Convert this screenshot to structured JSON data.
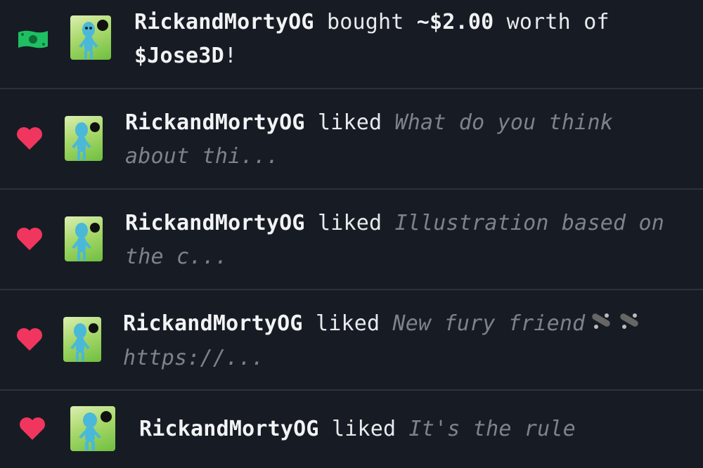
{
  "activity": [
    {
      "type": "buy",
      "icon": "money-icon",
      "user": "RickandMortyOG",
      "verb": "bought",
      "amount": "~$2.00",
      "mid": "worth of",
      "token": "$Jose3D",
      "end": "!"
    },
    {
      "type": "like",
      "icon": "heart-icon",
      "user": "RickandMortyOG",
      "verb": "liked",
      "snippet": "What do you think about thi..."
    },
    {
      "type": "like",
      "icon": "heart-icon",
      "user": "RickandMortyOG",
      "verb": "liked",
      "snippet": "Illustration based on the c..."
    },
    {
      "type": "like",
      "icon": "heart-icon",
      "user": "RickandMortyOG",
      "verb": "liked",
      "snippet_start": "New fury friend",
      "snippet_emoji": "skateboard-icon",
      "snippet_end": "https://..."
    },
    {
      "type": "like",
      "icon": "heart-icon",
      "user": "RickandMortyOG",
      "verb": "liked",
      "snippet": "It's the rule"
    }
  ],
  "colors": {
    "background": "#171c24",
    "divider": "#2c323b",
    "heart": "#f0365f",
    "money": "#1fbf63",
    "snippet": "#7d838c"
  }
}
